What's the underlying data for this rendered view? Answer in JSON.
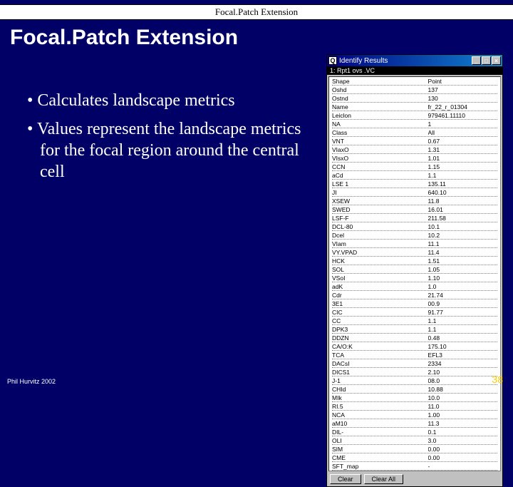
{
  "header": {
    "band": "Focal.Patch Extension"
  },
  "title": "Focal.Patch Extension",
  "bullets": [
    "Calculates landscape metrics",
    "Values represent the landscape metrics for the focal region around the central cell"
  ],
  "panel": {
    "titlebar": "Identify Results",
    "subhead": "1: Rpt1 ovs .VC",
    "rows": [
      {
        "k": "Shape",
        "v": "Point"
      },
      {
        "k": "Oshd",
        "v": "137"
      },
      {
        "k": "Ostnd",
        "v": "130"
      },
      {
        "k": "Name",
        "v": "fr_22_r_01304"
      },
      {
        "k": "Leiclon",
        "v": "979461.11110"
      },
      {
        "k": "NA",
        "v": "1"
      },
      {
        "k": "Class",
        "v": "All"
      },
      {
        "k": "VNT",
        "v": "0.67"
      },
      {
        "k": "VIaxO",
        "v": "1.31"
      },
      {
        "k": "VIsxO",
        "v": "1.01"
      },
      {
        "k": "CCN",
        "v": "1.15"
      },
      {
        "k": "aCd",
        "v": "1.1"
      },
      {
        "k": "LSE 1",
        "v": "135.11"
      },
      {
        "k": "JI",
        "v": "640.10"
      },
      {
        "k": "XSEW",
        "v": "11.8"
      },
      {
        "k": "SWED",
        "v": "16.01"
      },
      {
        "k": "LSF-F",
        "v": "211.58"
      },
      {
        "k": "DCL-80",
        "v": "10.1"
      },
      {
        "k": "Dcel",
        "v": "10.2"
      },
      {
        "k": "VIam",
        "v": "11.1"
      },
      {
        "k": "VY.VPAD",
        "v": "11.4"
      },
      {
        "k": "HCK",
        "v": "1.51"
      },
      {
        "k": "SOL",
        "v": "1.05"
      },
      {
        "k": "VSoI",
        "v": "1.10"
      },
      {
        "k": "adK",
        "v": "1.0"
      },
      {
        "k": "Cdr",
        "v": "21.74"
      },
      {
        "k": "3E1",
        "v": "00.9"
      },
      {
        "k": "CIC",
        "v": "91.77"
      },
      {
        "k": "CC",
        "v": "1.1"
      },
      {
        "k": "DPK3",
        "v": "1.1"
      },
      {
        "k": "DDZN",
        "v": "0.48"
      },
      {
        "k": "CA/O:K",
        "v": "175.10"
      },
      {
        "k": "TCA",
        "v": "EFL3"
      },
      {
        "k": "DACsI",
        "v": "2334"
      },
      {
        "k": "DICS1",
        "v": "2.10"
      },
      {
        "k": "J-1",
        "v": "08.0"
      },
      {
        "k": "CHId",
        "v": "10.88"
      },
      {
        "k": "MIk",
        "v": "10.0"
      },
      {
        "k": "RI.5",
        "v": "11.0"
      },
      {
        "k": "NCA",
        "v": "1.00"
      },
      {
        "k": "aM10",
        "v": "11.3"
      },
      {
        "k": "DIL-",
        "v": "0.1"
      },
      {
        "k": "OLI",
        "v": "3.0"
      },
      {
        "k": "SIM",
        "v": "0.00"
      },
      {
        "k": "CME",
        "v": "0.00"
      },
      {
        "k": "SFT_map",
        "v": "-"
      }
    ],
    "buttons": {
      "clear": "Clear",
      "clearAll": "Clear All"
    }
  },
  "footer": {
    "left": "Phil Hurvitz 2002",
    "right": "38"
  }
}
